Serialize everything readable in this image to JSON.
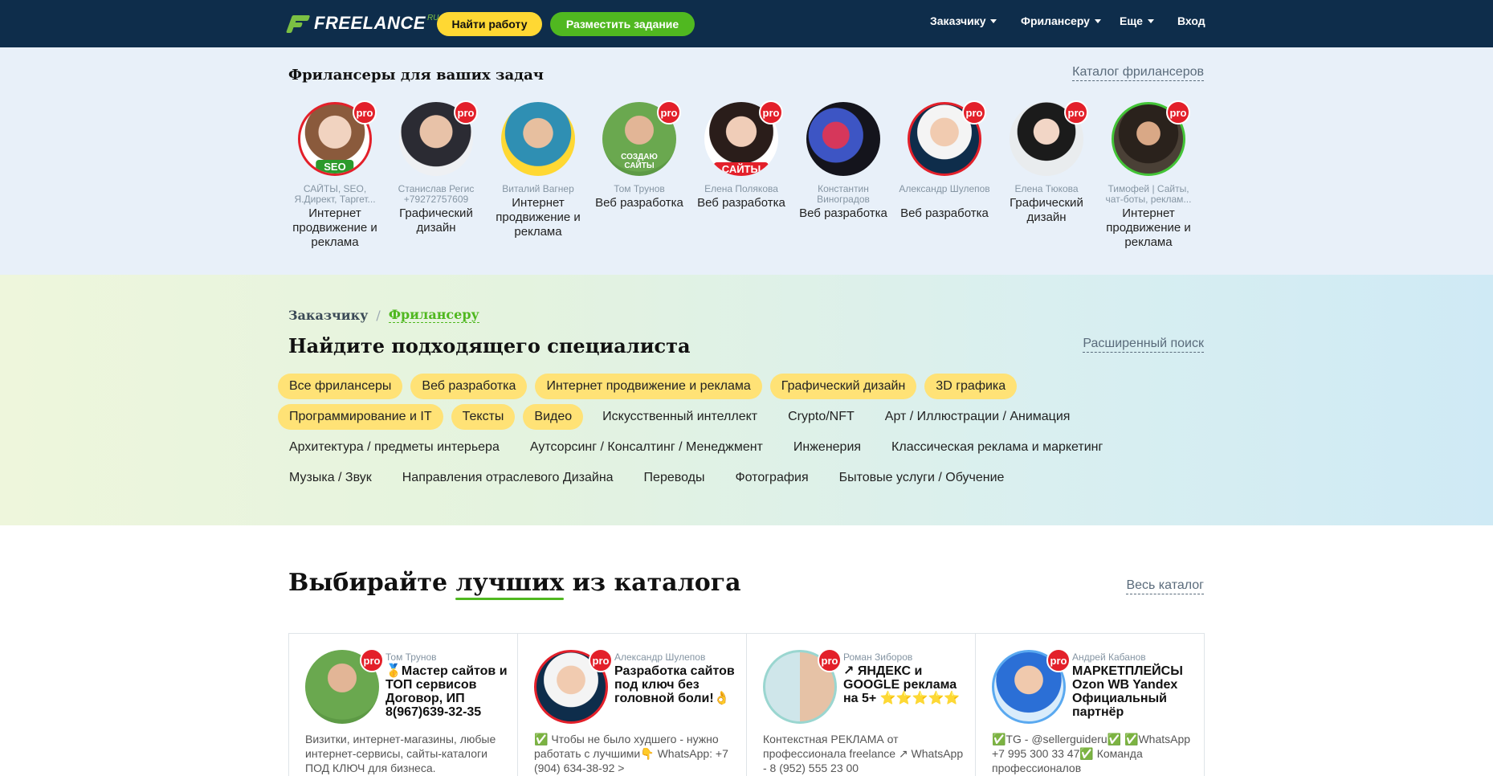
{
  "header": {
    "logo_text": "FREELANCE",
    "logo_suffix": "RU",
    "find_work": "Найти работу",
    "post_task": "Разместить задание",
    "nav": [
      "Заказчику",
      "Фрилансеру",
      "Еще",
      "Вход"
    ]
  },
  "top_freelancers": {
    "title": "Фрилансеры для ваших задач",
    "catalog_link": "Каталог фрилансеров",
    "pro_label": "pro",
    "items": [
      {
        "name": "САЙТЫ, SEO, Я.Директ, Таргет...",
        "spec": "Интернет продвижение и реклама",
        "badge": "SEO",
        "pro": true
      },
      {
        "name": "Станислав Регис +79272757609",
        "spec": "Графический дизайн",
        "pro": true
      },
      {
        "name": "Виталий Вагнер",
        "spec": "Интернет продвижение и реклама",
        "pro": false
      },
      {
        "name": "Том Трунов",
        "spec": "Веб разработка",
        "badge": "СОЗДАЮ САЙТЫ",
        "pro": true
      },
      {
        "name": "Елена Полякова",
        "spec": "Веб разработка",
        "badge": "САЙТЫ",
        "pro": true
      },
      {
        "name": "Константин Виноградов",
        "spec": "Веб разработка",
        "pro": false
      },
      {
        "name": "Александр Шулепов",
        "spec": "Веб разработка",
        "pro": true
      },
      {
        "name": "Елена Тюкова",
        "spec": "Графический дизайн",
        "pro": true
      },
      {
        "name": "Тимофей | Сайты, чат-боты, реклам...",
        "spec": "Интернет продвижение и реклама",
        "pro": true
      }
    ]
  },
  "search": {
    "breadcrumb": [
      "Заказчику",
      "/",
      "Фрилансеру"
    ],
    "title": "Найдите подходящего специалиста",
    "advanced_link": "Расширенный поиск",
    "rows": [
      [
        {
          "label": "Все фрилансеры",
          "hl": true
        },
        {
          "label": "Веб разработка",
          "hl": true
        },
        {
          "label": "Интернет продвижение и реклама",
          "hl": true
        },
        {
          "label": "Графический дизайн",
          "hl": true
        },
        {
          "label": "3D графика",
          "hl": true
        }
      ],
      [
        {
          "label": "Программирование и IT",
          "hl": true
        },
        {
          "label": "Тексты",
          "hl": true
        },
        {
          "label": "Видео",
          "hl": true
        },
        {
          "label": "Искусственный интеллект",
          "hl": false
        },
        {
          "label": "Crypto/NFT",
          "hl": false
        },
        {
          "label": "Арт / Иллюстрации / Анимация",
          "hl": false
        }
      ],
      [
        {
          "label": "Архитектура / предметы интерьера",
          "hl": false
        },
        {
          "label": "Аутсорсинг / Консалтинг / Менеджмент",
          "hl": false
        },
        {
          "label": "Инженерия",
          "hl": false
        },
        {
          "label": "Классическая реклама и маркетинг",
          "hl": false
        }
      ],
      [
        {
          "label": "Музыка / Звук",
          "hl": false
        },
        {
          "label": "Направления отраслевого Дизайна",
          "hl": false
        },
        {
          "label": "Переводы",
          "hl": false
        },
        {
          "label": "Фотография",
          "hl": false
        },
        {
          "label": "Бытовые услуги / Обучение",
          "hl": false
        }
      ]
    ]
  },
  "best": {
    "title_pre": "Выбирайте ",
    "title_hl": "лучших",
    "title_post": " из каталога",
    "all_link": "Весь каталог",
    "cards": [
      {
        "author": "Том Трунов",
        "title": "🥇Мастер сайтов и ТОП сервисов Договор, ИП 8(967)639-32-35",
        "desc": "Визитки, интернет-магазины, любые интернет-сервисы, сайты-каталоги ПОД КЛЮЧ для бизнеса."
      },
      {
        "author": "Александр Шулепов",
        "title": "Разработка сайтов под ключ без головной боли!👌",
        "desc": "✅ Чтобы не было худшего - нужно работать с лучшими👇 WhatsApp: +7 (904) 634-38-92 >"
      },
      {
        "author": "Роман Зиборов",
        "title": "↗ ЯНДЕКС и GOOGLE реклама на 5+ ⭐⭐⭐⭐⭐",
        "desc": "Контекстная РЕКЛАМА от профессионала freelance ↗ WhatsApp - 8 (952) 555 23 00"
      },
      {
        "author": "Андрей Кабанов",
        "title": "МАРКЕТПЛЕЙСЫ Ozon WB Yandex Официальный партнёр",
        "desc": "✅TG - @sellerguideru✅ ✅WhatsApp +7 995 300 33 47✅ Команда профессионалов"
      }
    ]
  },
  "colors": {
    "header_bg": "#0e2d4b",
    "yellow": "#ffd833",
    "green": "#50b820",
    "pro_red": "#e3202a"
  }
}
